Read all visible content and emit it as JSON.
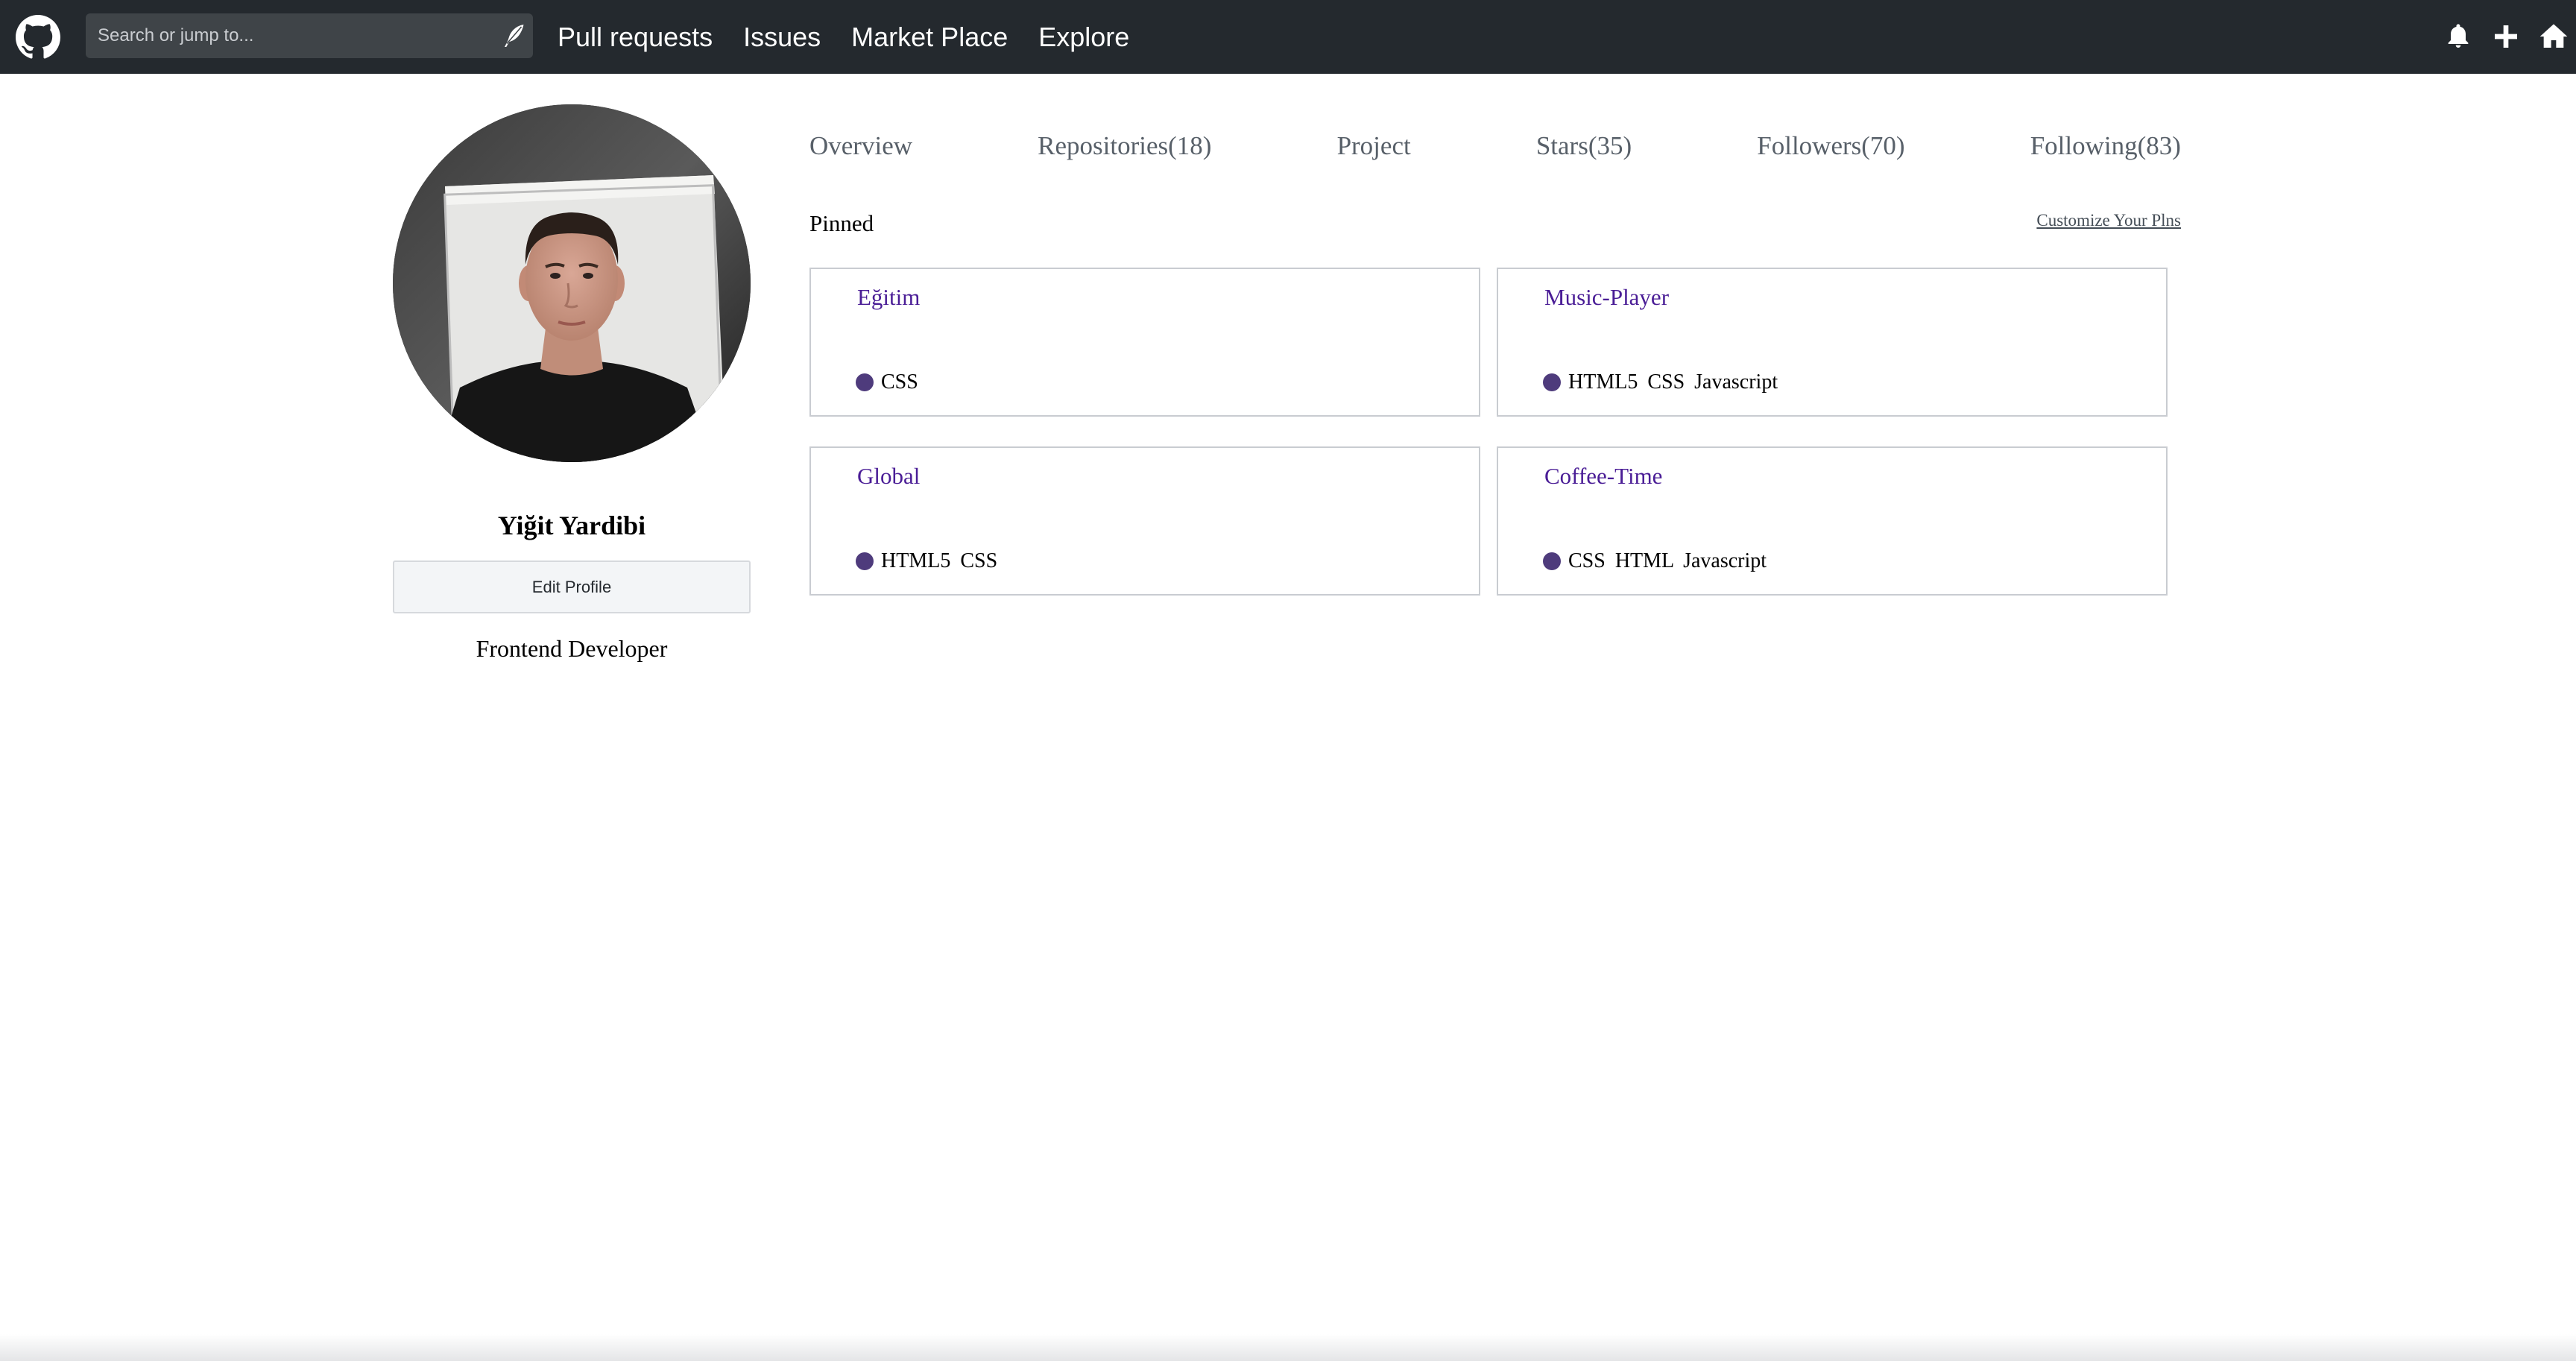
{
  "topbar": {
    "logo_icon": "github-octocat-icon",
    "search": {
      "placeholder": "Search or jump to...",
      "value": "",
      "icon": "feather-icon"
    },
    "nav": [
      {
        "label": "Pull requests"
      },
      {
        "label": "Issues"
      },
      {
        "label": "Market Place"
      },
      {
        "label": "Explore"
      }
    ],
    "right_icons": [
      "bell-icon",
      "plus-icon",
      "home-icon"
    ],
    "background_color": "#24292e"
  },
  "profile": {
    "avatar_icon": "avatar-photo",
    "name": "Yiğit Yardibi",
    "edit_button": "Edit Profile",
    "bio": "Frontend Developer"
  },
  "tabs": [
    {
      "label": "Overview"
    },
    {
      "label": "Repositories(18)"
    },
    {
      "label": "Project"
    },
    {
      "label": "Stars(35)"
    },
    {
      "label": "Followers(70)"
    },
    {
      "label": "Following(83)"
    }
  ],
  "pinned": {
    "label": "Pinned",
    "customize_link": "Customize Your Plns",
    "repos": [
      {
        "title": "Eğitim",
        "languages": "CSS"
      },
      {
        "title": "Music-Player",
        "languages": "HTML5 CSS Javascript"
      },
      {
        "title": "Global",
        "languages": "HTML5 CSS"
      },
      {
        "title": "Coffee-Time",
        "languages": "CSS HTML Javascript"
      }
    ],
    "title_color": "#4a1d96",
    "language_dot_color": "#4e3b7c"
  }
}
